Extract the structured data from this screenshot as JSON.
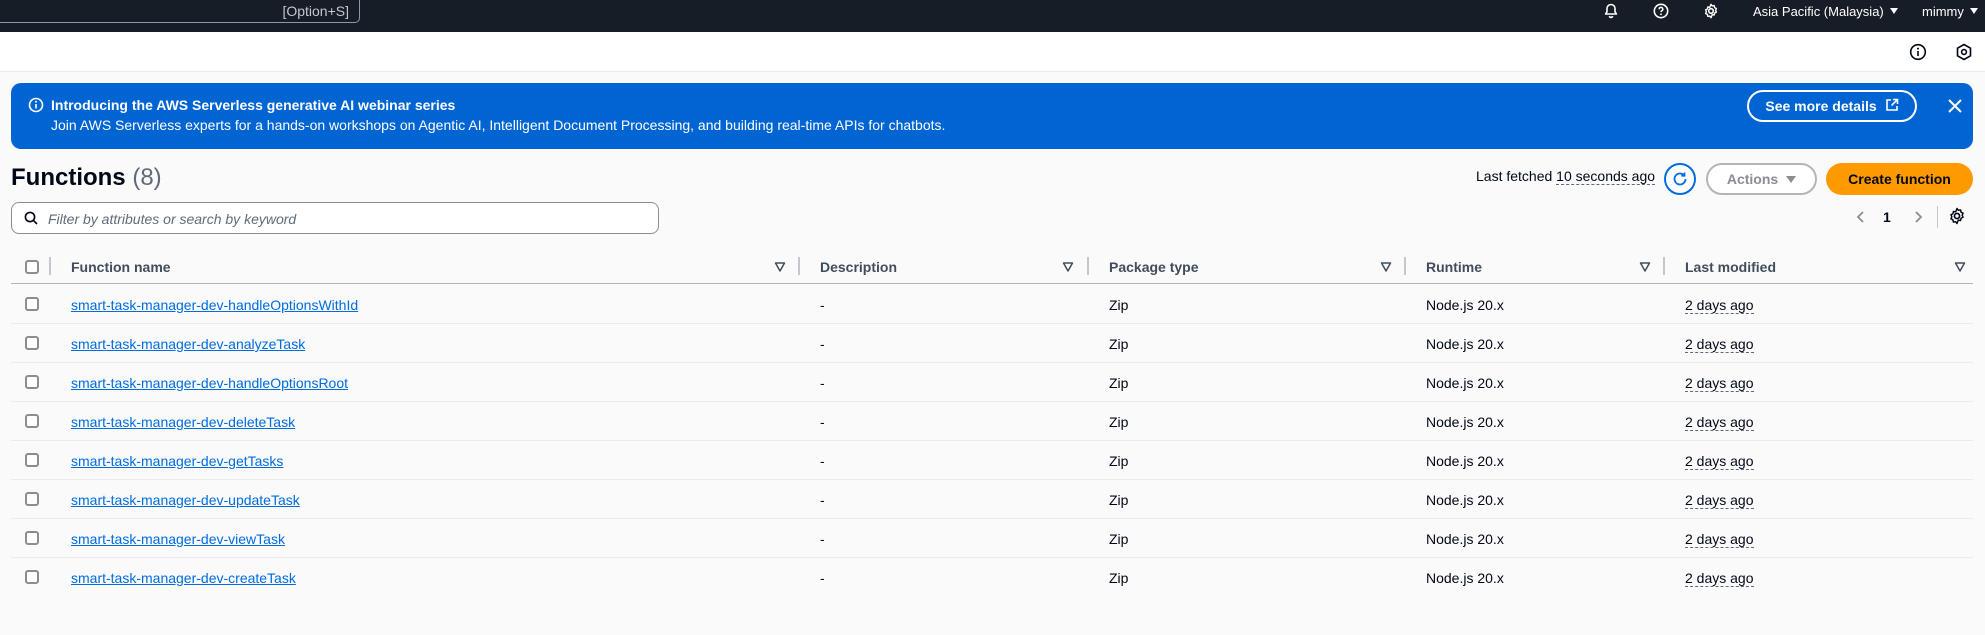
{
  "topnav": {
    "search_shortcut": "[Option+S]",
    "region": "Asia Pacific (Malaysia)",
    "user": "mimmy"
  },
  "banner": {
    "title": "Introducing the AWS Serverless generative AI webinar series",
    "body": "Join AWS Serverless experts for a hands-on workshops on Agentic AI, Intelligent Document Processing, and building real-time APIs for chatbots.",
    "cta_label": "See more details"
  },
  "functions": {
    "title": "Functions",
    "count": "(8)",
    "last_fetched_label": "Last fetched",
    "last_fetched_value": "10 seconds ago",
    "actions_label": "Actions",
    "create_label": "Create function",
    "filter_placeholder": "Filter by attributes or search by keyword",
    "page": "1"
  },
  "table": {
    "columns": {
      "name": "Function name",
      "description": "Description",
      "package": "Package type",
      "runtime": "Runtime",
      "modified": "Last modified"
    },
    "rows": [
      {
        "name": "smart-task-manager-dev-handleOptionsWithId",
        "description": "-",
        "package": "Zip",
        "runtime": "Node.js 20.x",
        "modified": "2 days ago"
      },
      {
        "name": "smart-task-manager-dev-analyzeTask",
        "description": "-",
        "package": "Zip",
        "runtime": "Node.js 20.x",
        "modified": "2 days ago"
      },
      {
        "name": "smart-task-manager-dev-handleOptionsRoot",
        "description": "-",
        "package": "Zip",
        "runtime": "Node.js 20.x",
        "modified": "2 days ago"
      },
      {
        "name": "smart-task-manager-dev-deleteTask",
        "description": "-",
        "package": "Zip",
        "runtime": "Node.js 20.x",
        "modified": "2 days ago"
      },
      {
        "name": "smart-task-manager-dev-getTasks",
        "description": "-",
        "package": "Zip",
        "runtime": "Node.js 20.x",
        "modified": "2 days ago"
      },
      {
        "name": "smart-task-manager-dev-updateTask",
        "description": "-",
        "package": "Zip",
        "runtime": "Node.js 20.x",
        "modified": "2 days ago"
      },
      {
        "name": "smart-task-manager-dev-viewTask",
        "description": "-",
        "package": "Zip",
        "runtime": "Node.js 20.x",
        "modified": "2 days ago"
      },
      {
        "name": "smart-task-manager-dev-createTask",
        "description": "-",
        "package": "Zip",
        "runtime": "Node.js 20.x",
        "modified": "2 days ago"
      }
    ]
  },
  "colors": {
    "nav_bg": "#161d26",
    "banner_bg": "#0064d2",
    "primary_button": "#ff9900",
    "link": "#006ce0"
  },
  "icons": [
    "bell-icon",
    "help-icon",
    "gear-icon",
    "info-icon",
    "external-link-icon",
    "close-icon",
    "refresh-icon",
    "search-icon",
    "chevron-left-icon",
    "chevron-right-icon",
    "sort-icon"
  ]
}
